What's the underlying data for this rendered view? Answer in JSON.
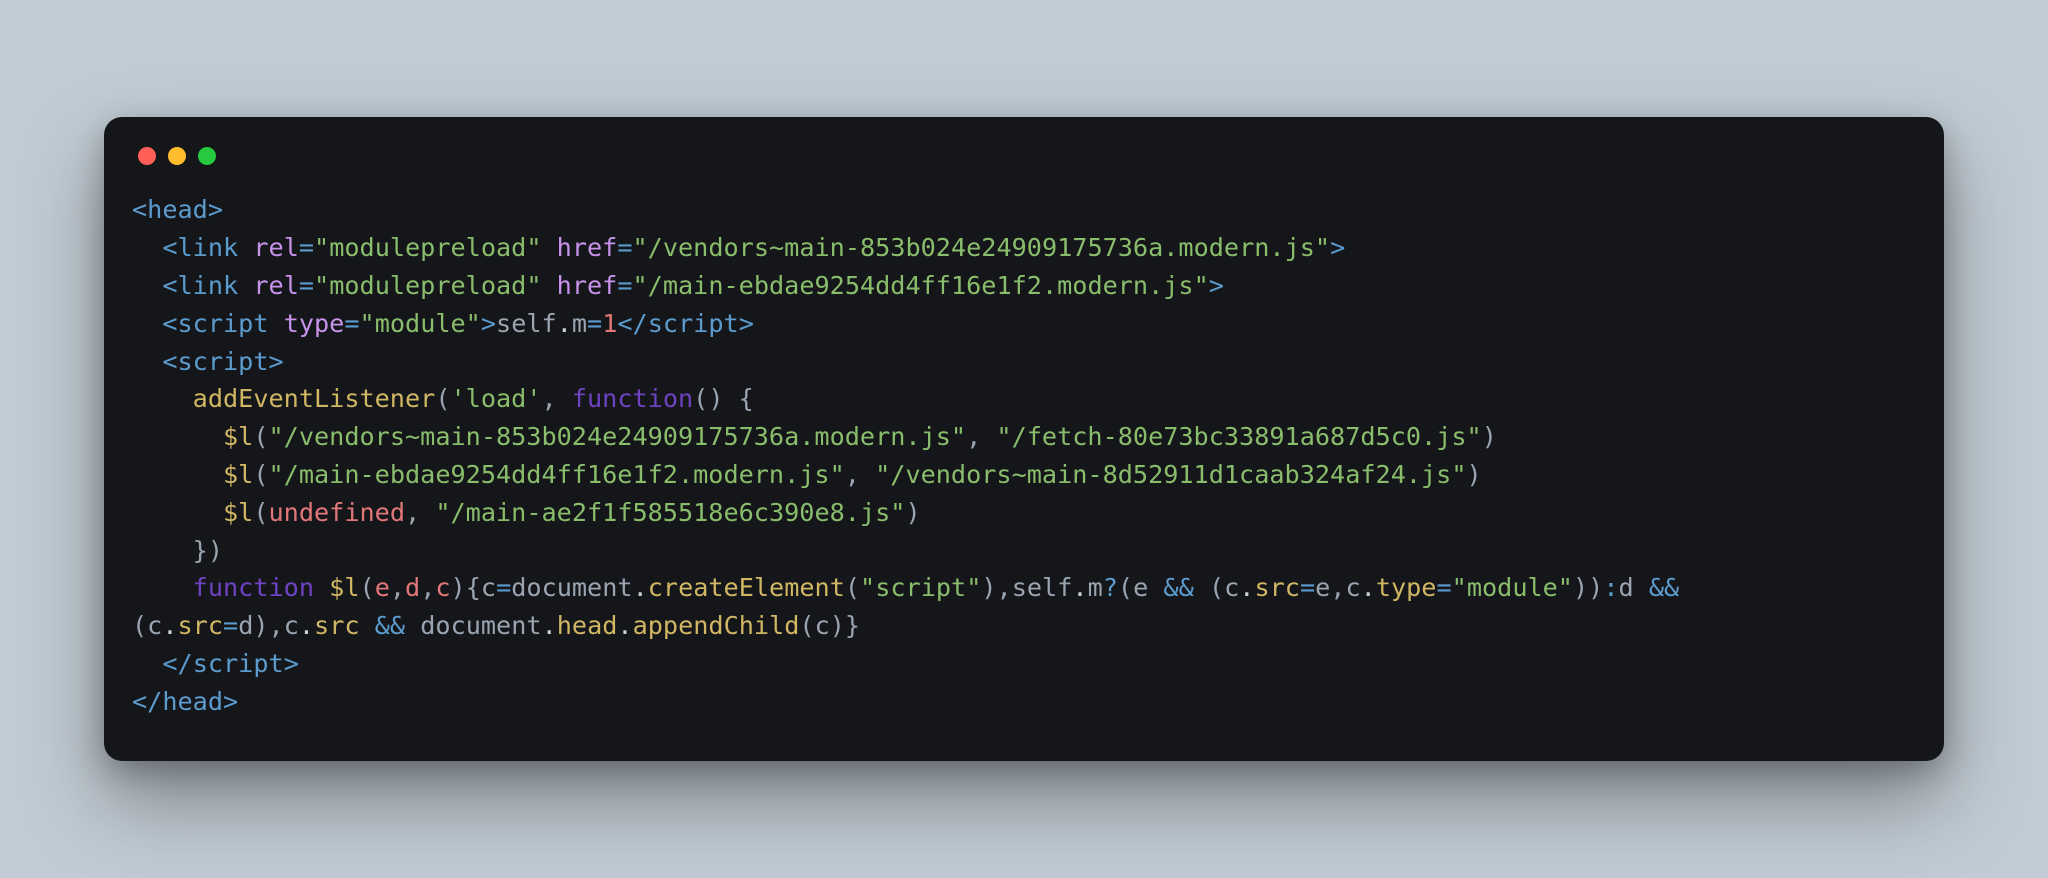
{
  "window": {
    "traffic_lights": [
      "close",
      "minimize",
      "zoom"
    ]
  },
  "code": {
    "lines": [
      {
        "indent": 0,
        "tokens": [
          {
            "c": "t-punc",
            "t": "<"
          },
          {
            "c": "t-tag",
            "t": "head"
          },
          {
            "c": "t-punc",
            "t": ">"
          }
        ]
      },
      {
        "indent": 1,
        "tokens": [
          {
            "c": "t-punc",
            "t": "<"
          },
          {
            "c": "t-tag",
            "t": "link"
          },
          {
            "c": "",
            "t": " "
          },
          {
            "c": "t-attr",
            "t": "rel"
          },
          {
            "c": "t-op",
            "t": "="
          },
          {
            "c": "t-str",
            "t": "\"modulepreload\""
          },
          {
            "c": "",
            "t": " "
          },
          {
            "c": "t-attr",
            "t": "href"
          },
          {
            "c": "t-op",
            "t": "="
          },
          {
            "c": "t-strfile",
            "t": "\"/vendors~main-853b024e24909175736a.modern.js\""
          },
          {
            "c": "t-punc",
            "t": ">"
          }
        ]
      },
      {
        "indent": 1,
        "tokens": [
          {
            "c": "t-punc",
            "t": "<"
          },
          {
            "c": "t-tag",
            "t": "link"
          },
          {
            "c": "",
            "t": " "
          },
          {
            "c": "t-attr",
            "t": "rel"
          },
          {
            "c": "t-op",
            "t": "="
          },
          {
            "c": "t-str",
            "t": "\"modulepreload\""
          },
          {
            "c": "",
            "t": " "
          },
          {
            "c": "t-attr",
            "t": "href"
          },
          {
            "c": "t-op",
            "t": "="
          },
          {
            "c": "t-strfile",
            "t": "\"/main-ebdae9254dd4ff16e1f2.modern.js\""
          },
          {
            "c": "t-punc",
            "t": ">"
          }
        ]
      },
      {
        "indent": 1,
        "tokens": [
          {
            "c": "t-punc",
            "t": "<"
          },
          {
            "c": "t-tag",
            "t": "script"
          },
          {
            "c": "",
            "t": " "
          },
          {
            "c": "t-attr",
            "t": "type"
          },
          {
            "c": "t-op",
            "t": "="
          },
          {
            "c": "t-str",
            "t": "\"module\""
          },
          {
            "c": "t-punc",
            "t": ">"
          },
          {
            "c": "t-body",
            "t": "self"
          },
          {
            "c": "t-dot",
            "t": "."
          },
          {
            "c": "t-body",
            "t": "m"
          },
          {
            "c": "t-op",
            "t": "="
          },
          {
            "c": "t-num",
            "t": "1"
          },
          {
            "c": "t-punc",
            "t": "</"
          },
          {
            "c": "t-tag",
            "t": "script"
          },
          {
            "c": "t-punc",
            "t": ">"
          }
        ]
      },
      {
        "indent": 1,
        "tokens": [
          {
            "c": "t-punc",
            "t": "<"
          },
          {
            "c": "t-tag",
            "t": "script"
          },
          {
            "c": "t-punc",
            "t": ">"
          }
        ]
      },
      {
        "indent": 2,
        "tokens": [
          {
            "c": "t-call",
            "t": "addEventListener"
          },
          {
            "c": "t-paren",
            "t": "("
          },
          {
            "c": "t-str",
            "t": "'load'"
          },
          {
            "c": "t-body",
            "t": ", "
          },
          {
            "c": "t-kw",
            "t": "function"
          },
          {
            "c": "t-paren",
            "t": "()"
          },
          {
            "c": "",
            "t": " "
          },
          {
            "c": "t-paren",
            "t": "{"
          }
        ]
      },
      {
        "indent": 3,
        "tokens": [
          {
            "c": "t-call",
            "t": "$l"
          },
          {
            "c": "t-paren",
            "t": "("
          },
          {
            "c": "t-strfile",
            "t": "\"/vendors~main-853b024e24909175736a.modern.js\""
          },
          {
            "c": "t-body",
            "t": ", "
          },
          {
            "c": "t-strfile",
            "t": "\"/fetch-80e73bc33891a687d5c0.js\""
          },
          {
            "c": "t-paren",
            "t": ")"
          }
        ]
      },
      {
        "indent": 3,
        "tokens": [
          {
            "c": "t-call",
            "t": "$l"
          },
          {
            "c": "t-paren",
            "t": "("
          },
          {
            "c": "t-strfile",
            "t": "\"/main-ebdae9254dd4ff16e1f2.modern.js\""
          },
          {
            "c": "t-body",
            "t": ", "
          },
          {
            "c": "t-strfile",
            "t": "\"/vendors~main-8d52911d1caab324af24.js\""
          },
          {
            "c": "t-paren",
            "t": ")"
          }
        ]
      },
      {
        "indent": 3,
        "tokens": [
          {
            "c": "t-call",
            "t": "$l"
          },
          {
            "c": "t-paren",
            "t": "("
          },
          {
            "c": "t-undef",
            "t": "undefined"
          },
          {
            "c": "t-body",
            "t": ", "
          },
          {
            "c": "t-strfile",
            "t": "\"/main-ae2f1f585518e6c390e8.js\""
          },
          {
            "c": "t-paren",
            "t": ")"
          }
        ]
      },
      {
        "indent": 2,
        "tokens": [
          {
            "c": "t-paren",
            "t": "}"
          },
          {
            "c": "t-paren",
            "t": ")"
          }
        ]
      },
      {
        "indent": 2,
        "tokens": [
          {
            "c": "t-kw",
            "t": "function"
          },
          {
            "c": "",
            "t": " "
          },
          {
            "c": "t-func",
            "t": "$l"
          },
          {
            "c": "t-paren",
            "t": "("
          },
          {
            "c": "t-var",
            "t": "e"
          },
          {
            "c": "t-body",
            "t": ","
          },
          {
            "c": "t-var",
            "t": "d"
          },
          {
            "c": "t-body",
            "t": ","
          },
          {
            "c": "t-var",
            "t": "c"
          },
          {
            "c": "t-paren",
            "t": ")"
          },
          {
            "c": "t-paren",
            "t": "{"
          },
          {
            "c": "t-body",
            "t": "c"
          },
          {
            "c": "t-op",
            "t": "="
          },
          {
            "c": "t-body",
            "t": "document"
          },
          {
            "c": "t-dot",
            "t": "."
          },
          {
            "c": "t-call",
            "t": "createElement"
          },
          {
            "c": "t-paren",
            "t": "("
          },
          {
            "c": "t-str",
            "t": "\"script\""
          },
          {
            "c": "t-paren",
            "t": ")"
          },
          {
            "c": "t-body",
            "t": ","
          },
          {
            "c": "t-body",
            "t": "self"
          },
          {
            "c": "t-dot",
            "t": "."
          },
          {
            "c": "t-body",
            "t": "m"
          },
          {
            "c": "t-op",
            "t": "?"
          },
          {
            "c": "t-paren",
            "t": "("
          },
          {
            "c": "t-body",
            "t": "e "
          },
          {
            "c": "t-op",
            "t": "&&"
          },
          {
            "c": "",
            "t": " "
          },
          {
            "c": "t-paren",
            "t": "("
          },
          {
            "c": "t-body",
            "t": "c"
          },
          {
            "c": "t-dot",
            "t": "."
          },
          {
            "c": "t-prop",
            "t": "src"
          },
          {
            "c": "t-op",
            "t": "="
          },
          {
            "c": "t-body",
            "t": "e"
          },
          {
            "c": "t-body",
            "t": ","
          },
          {
            "c": "t-body",
            "t": "c"
          },
          {
            "c": "t-dot",
            "t": "."
          },
          {
            "c": "t-prop",
            "t": "type"
          },
          {
            "c": "t-op",
            "t": "="
          },
          {
            "c": "t-str",
            "t": "\"module\""
          },
          {
            "c": "t-paren",
            "t": ")"
          },
          {
            "c": "t-paren",
            "t": ")"
          },
          {
            "c": "t-op",
            "t": ":"
          },
          {
            "c": "t-body",
            "t": "d "
          },
          {
            "c": "t-op",
            "t": "&&"
          }
        ]
      },
      {
        "indent": 0,
        "tokens": [
          {
            "c": "t-paren",
            "t": "("
          },
          {
            "c": "t-body",
            "t": "c"
          },
          {
            "c": "t-dot",
            "t": "."
          },
          {
            "c": "t-prop",
            "t": "src"
          },
          {
            "c": "t-op",
            "t": "="
          },
          {
            "c": "t-body",
            "t": "d"
          },
          {
            "c": "t-paren",
            "t": ")"
          },
          {
            "c": "t-body",
            "t": ","
          },
          {
            "c": "t-body",
            "t": "c"
          },
          {
            "c": "t-dot",
            "t": "."
          },
          {
            "c": "t-prop",
            "t": "src"
          },
          {
            "c": "",
            "t": " "
          },
          {
            "c": "t-op",
            "t": "&&"
          },
          {
            "c": "",
            "t": " "
          },
          {
            "c": "t-body",
            "t": "document"
          },
          {
            "c": "t-dot",
            "t": "."
          },
          {
            "c": "t-prop",
            "t": "head"
          },
          {
            "c": "t-dot",
            "t": "."
          },
          {
            "c": "t-call",
            "t": "appendChild"
          },
          {
            "c": "t-paren",
            "t": "("
          },
          {
            "c": "t-body",
            "t": "c"
          },
          {
            "c": "t-paren",
            "t": ")"
          },
          {
            "c": "t-paren",
            "t": "}"
          }
        ]
      },
      {
        "indent": 1,
        "tokens": [
          {
            "c": "t-punc",
            "t": "</"
          },
          {
            "c": "t-tag",
            "t": "script"
          },
          {
            "c": "t-punc",
            "t": ">"
          }
        ]
      },
      {
        "indent": 0,
        "tokens": [
          {
            "c": "t-punc",
            "t": "</"
          },
          {
            "c": "t-tag",
            "t": "head"
          },
          {
            "c": "t-punc",
            "t": ">"
          }
        ]
      }
    ]
  }
}
